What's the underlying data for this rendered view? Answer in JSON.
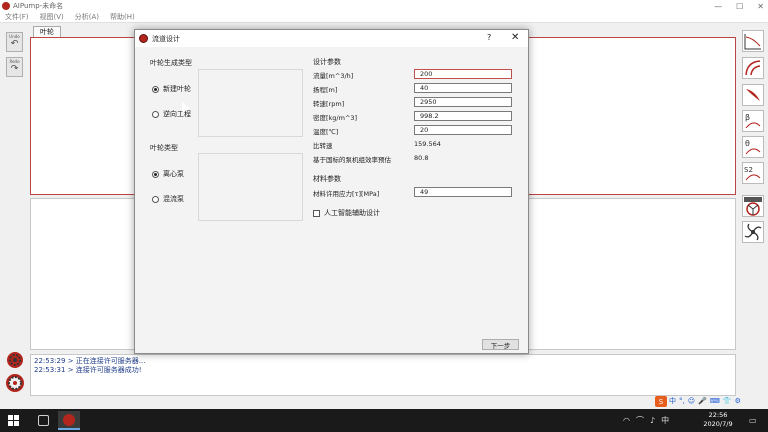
{
  "app": {
    "title": "AIPump-未命名",
    "controls": [
      "—",
      "☐",
      "✕"
    ]
  },
  "menu": [
    "文件(F)",
    "视图(V)",
    "分析(A)",
    "帮助(H)"
  ],
  "left_tools": [
    {
      "label": "Undo",
      "icon": "undo-arrow-icon"
    },
    {
      "label": "Redo",
      "icon": "redo-arrow-icon"
    }
  ],
  "doc_tab": "叶轮",
  "log": [
    {
      "time": "22:53:29",
      "text": "> 正在连接许可服务器..."
    },
    {
      "time": "22:53:31",
      "text": "> 连接许可服务器成功!"
    }
  ],
  "dialog": {
    "title": "流道设计",
    "help": "?",
    "close": "✕",
    "gen_type": {
      "title": "叶轮生成类型",
      "options": [
        "新建叶轮",
        "逆向工程"
      ],
      "selected": 0
    },
    "impeller_type": {
      "title": "叶轮类型",
      "options": [
        "离心泵",
        "混流泵"
      ],
      "selected": 0
    },
    "design_params": {
      "title": "设计参数",
      "fields": [
        {
          "label": "流量[m^3/h]",
          "value": "200"
        },
        {
          "label": "扬程[m]",
          "value": "40"
        },
        {
          "label": "转速[rpm]",
          "value": "2950"
        },
        {
          "label": "密度[kg/m^3]",
          "value": "998.2"
        },
        {
          "label": "温度[℃]",
          "value": "20"
        }
      ],
      "specific_speed_label": "比转速",
      "specific_speed_value": "159.564",
      "efficiency_label": "基于国标的泵机组效率预估",
      "efficiency_value": "80.8"
    },
    "material": {
      "title": "材料参数",
      "field_label": "材料许用应力[τ][MPa]",
      "field_value": "49"
    },
    "ai_checkbox": "人工智能辅助设计",
    "next_button": "下一步"
  },
  "taskbar": {
    "ime_text": "中",
    "time": "22:56",
    "date": "2020/7/9",
    "tray_lang": "中",
    "ime_bar": [
      "中",
      "°,",
      "☺",
      "🎤",
      "⌨",
      "👕",
      "⚙"
    ]
  },
  "colors": {
    "brand": "#b3261e",
    "active_input_border": "#c0504d",
    "log_text": "#1f3d8a",
    "taskbar": "#1a1a1a"
  }
}
